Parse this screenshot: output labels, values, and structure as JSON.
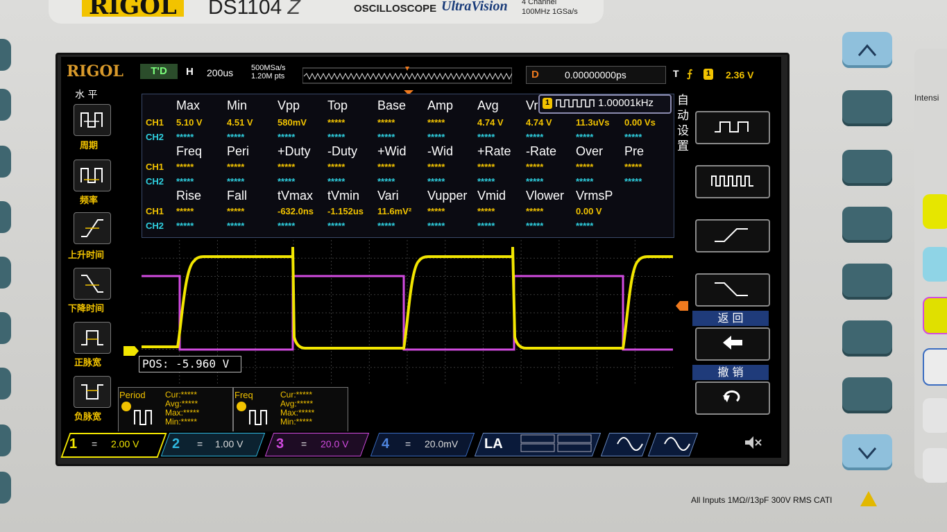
{
  "branding": {
    "brand": "RIGOL",
    "model": "DS1104",
    "model_suffix": "Z",
    "product": "OSCILLOSCOPE",
    "series": "UltraVision",
    "spec_line1": "4 Channel",
    "spec_line2": "100MHz 1GSa/s"
  },
  "status_bar": {
    "screen_logo": "RIGOL",
    "run_state": "T'D",
    "horizontal_label": "H",
    "timebase": "200us",
    "sample_rate": "500MSa/s",
    "memory_depth": "1.20M pts",
    "delay_label": "D",
    "delay_value": "0.00000000ps",
    "trigger_label": "T",
    "trigger_source": "1",
    "trigger_level": "2.36 V"
  },
  "left_menu": {
    "title": "水 平",
    "items": [
      {
        "label": "周期",
        "icon": "period-icon"
      },
      {
        "label": "频率",
        "icon": "frequency-icon"
      },
      {
        "label": "上升时间",
        "icon": "rise-time-icon"
      },
      {
        "label": "下降时间",
        "icon": "fall-time-icon"
      },
      {
        "label": "正脉宽",
        "icon": "positive-width-icon"
      },
      {
        "label": "负脉宽",
        "icon": "negative-width-icon"
      }
    ]
  },
  "measure": {
    "freq_readout_ch": "1",
    "freq_readout": "1.00001kHz",
    "row1_headers": [
      "Max",
      "Min",
      "Vpp",
      "Top",
      "Base",
      "Amp",
      "Avg",
      "Vr"
    ],
    "row1_ch1": [
      "5.10 V",
      "4.51 V",
      "580mV",
      "*****",
      "*****",
      "*****",
      "4.74 V",
      "4.74 V",
      "11.3uVs",
      "0.00 Vs"
    ],
    "row1_ch2": [
      "*****",
      "*****",
      "*****",
      "*****",
      "*****",
      "*****",
      "*****",
      "*****",
      "*****",
      "*****"
    ],
    "row2_headers": [
      "Freq",
      "Peri",
      "+Duty",
      "-Duty",
      "+Wid",
      "-Wid",
      "+Rate",
      "-Rate",
      "Over",
      "Pre"
    ],
    "row2_ch1": [
      "*****",
      "*****",
      "*****",
      "*****",
      "*****",
      "*****",
      "*****",
      "*****",
      "*****",
      "*****"
    ],
    "row2_ch2": [
      "*****",
      "*****",
      "*****",
      "*****",
      "*****",
      "*****",
      "*****",
      "*****",
      "*****",
      "*****"
    ],
    "row3_headers": [
      "Rise",
      "Fall",
      "tVmax",
      "tVmin",
      "Vari",
      "Vupper",
      "Vmid",
      "Vlower",
      "VrmsP"
    ],
    "row3_ch1": [
      "*****",
      "*****",
      "-632.0ns",
      "-1.152us",
      "11.6mV²",
      "*****",
      "*****",
      "*****",
      "0.00 V"
    ],
    "row3_ch2": [
      "*****",
      "*****",
      "*****",
      "*****",
      "*****",
      "*****",
      "*****",
      "*****",
      "*****"
    ],
    "ch1_label": "CH1",
    "ch2_label": "CH2"
  },
  "waveform": {
    "pos_readout": "POS: -5.960 V",
    "ch1_color": "#f2e600",
    "ch3_color": "#d24be0"
  },
  "right_menu": {
    "title": "自动设置",
    "back_label": "返 回",
    "undo_label": "撤 销"
  },
  "counters": [
    {
      "label": "Period",
      "cur": "Cur:*****",
      "avg": "Avg:*****",
      "max": "Max:*****",
      "min": "Min:*****"
    },
    {
      "label": "Freq",
      "cur": "Cur:*****",
      "avg": "Avg:*****",
      "max": "Max:*****",
      "min": "Min:*****"
    }
  ],
  "channels": [
    {
      "num": "1",
      "coupling": "=",
      "scale": "2.00 V",
      "color": "#f2e600"
    },
    {
      "num": "2",
      "coupling": "=",
      "scale": "1.00 V",
      "color": "#2fb8e0"
    },
    {
      "num": "3",
      "coupling": "=",
      "scale": "20.0 V",
      "color": "#d24be0"
    },
    {
      "num": "4",
      "coupling": "=",
      "scale": "20.0mV",
      "color": "#3a6cc0"
    }
  ],
  "la_label": "LA",
  "front_panel": {
    "intensity": "Intensi",
    "inputs_note": "All Inputs 1MΩ//13pF 300V RMS  CATI"
  }
}
